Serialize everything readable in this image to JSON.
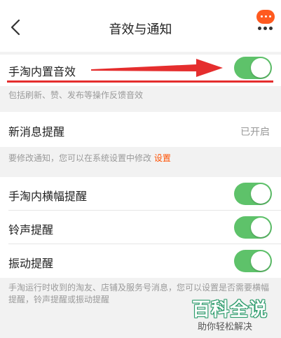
{
  "header": {
    "title": "音效与通知",
    "back_icon": "chevron-left-icon",
    "more_icon": "more-dots-icon",
    "bubble_color": "#ff5a1f"
  },
  "sound_section": {
    "label": "手淘内置音效",
    "toggle_on": true,
    "note": "包括刷新、赞、发布等操作反馈音效"
  },
  "message_section": {
    "label": "新消息提醒",
    "status": "已开启",
    "note_text": "要修改通知，您可以在系统设置中修改",
    "note_link": "设置"
  },
  "alert_section": {
    "items": [
      {
        "label": "手淘内横幅提醒",
        "toggle_on": true
      },
      {
        "label": "铃声提醒",
        "toggle_on": true
      },
      {
        "label": "振动提醒",
        "toggle_on": true
      }
    ],
    "note": "手淘运行时收到的淘友、店铺及服务号消息，您可以设置是否需要横幅提醒，铃声提醒或振动提醒"
  },
  "watermark": {
    "title": "百科全说",
    "subtitle": "助你轻松解决"
  },
  "colors": {
    "toggle_on": "#5ec26a",
    "accent": "#ff5000",
    "annotation_red": "#e52e2e"
  }
}
